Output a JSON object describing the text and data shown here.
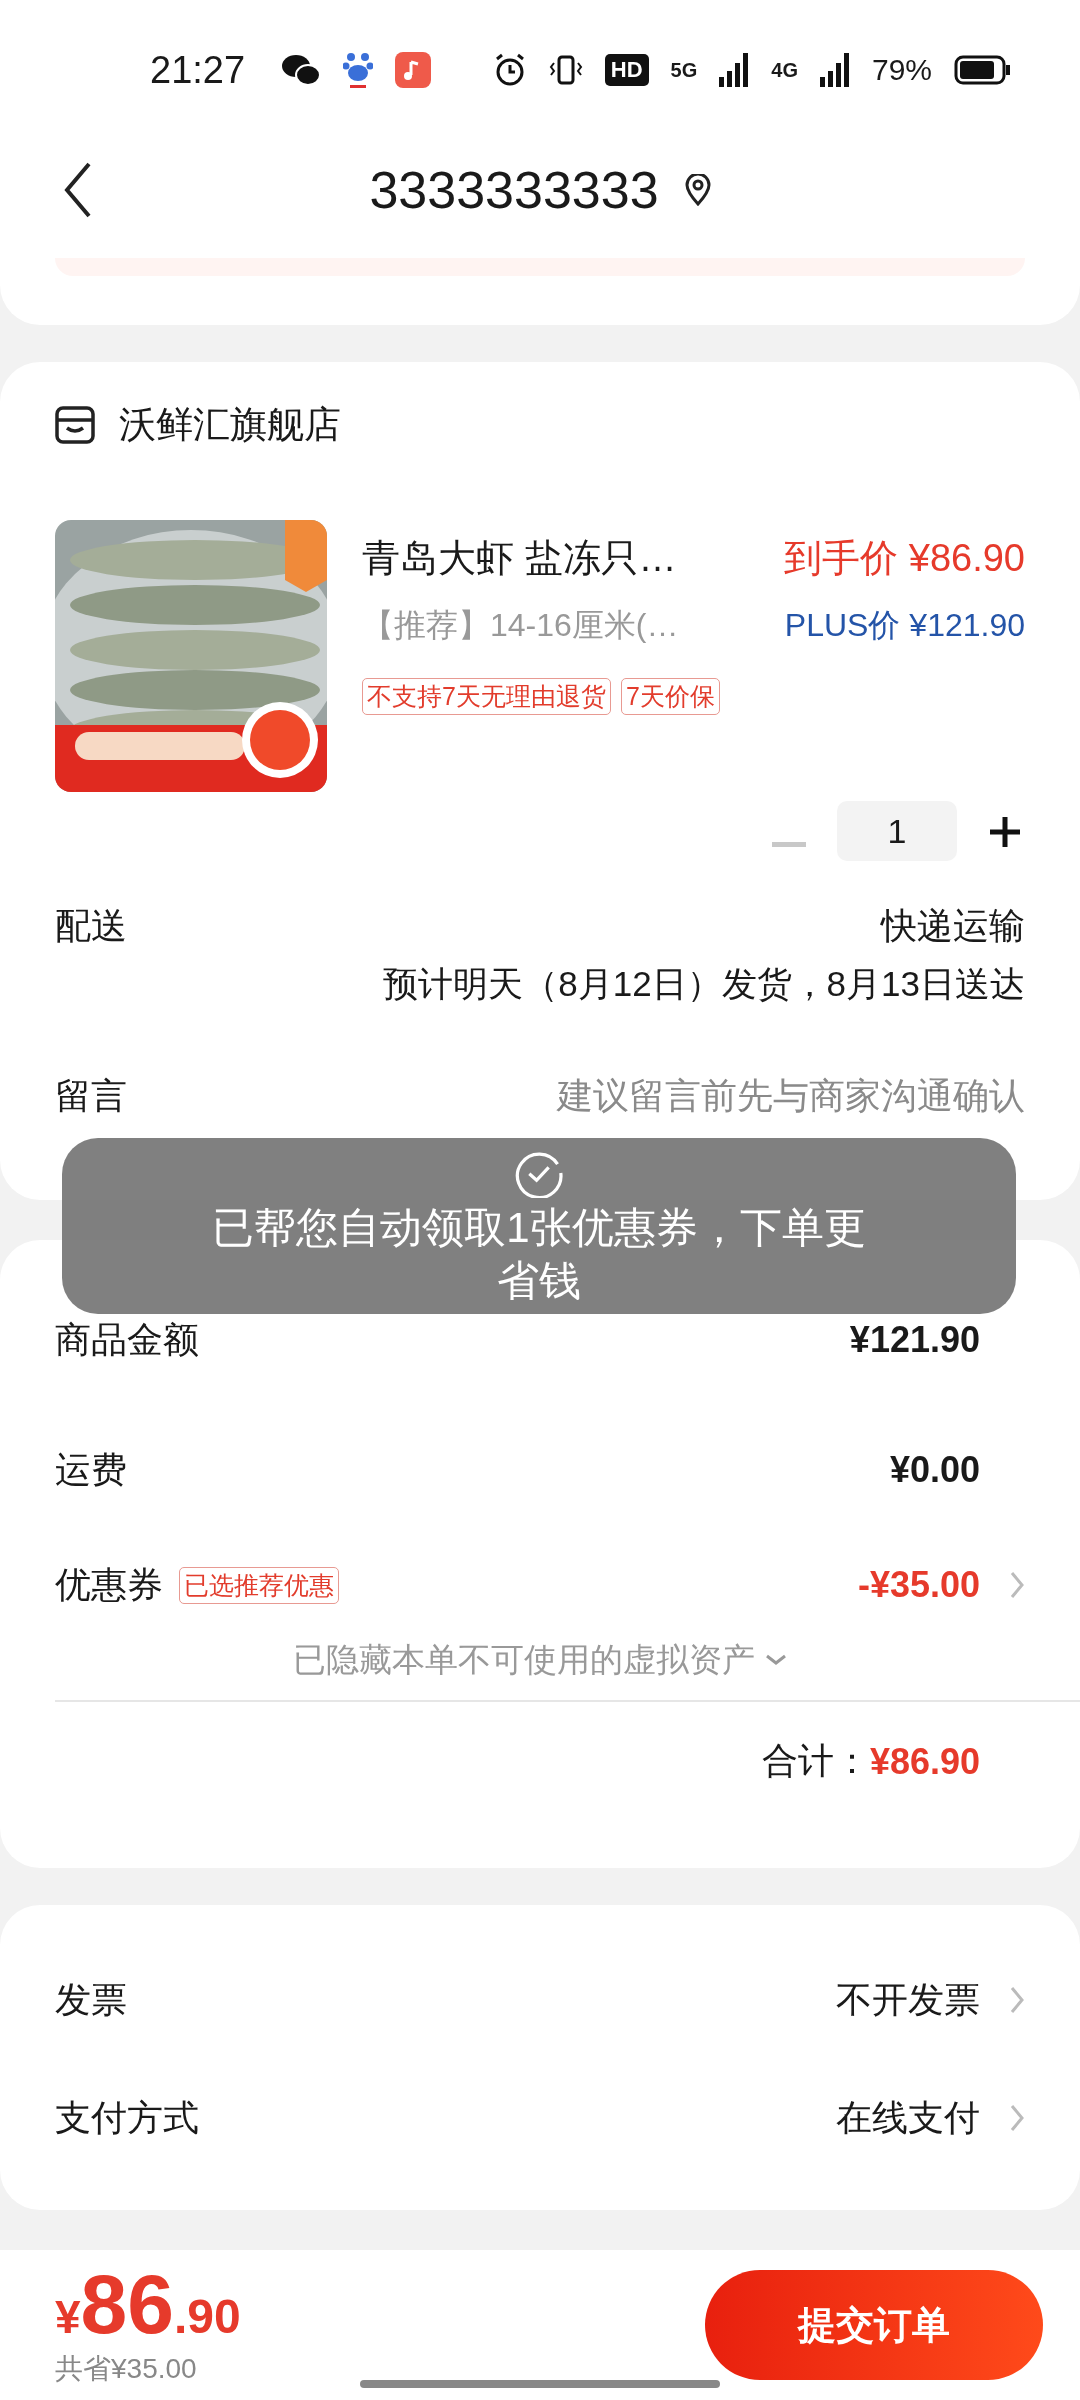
{
  "status_bar": {
    "time": "21:27",
    "hd": "HD",
    "networks": [
      "5G",
      "4G"
    ],
    "battery": "79%"
  },
  "header": {
    "title": "3333333333"
  },
  "store": {
    "name": "沃鲜汇旗舰店"
  },
  "product": {
    "title": "青岛大虾 盐冻只…",
    "spec": "【推荐】14-16厘米(…",
    "final_price": "到手价 ¥86.90",
    "plus_price": "PLUS价 ¥121.90",
    "tags": [
      "不支持7天无理由退货",
      "7天价保"
    ],
    "quantity": "1",
    "minus_disabled": true
  },
  "delivery": {
    "label": "配送",
    "method": "快递运输",
    "estimate": "预计明天（8月12日）发货，8月13日送达"
  },
  "message": {
    "label": "留言",
    "placeholder": "建议留言前先与商家沟通确认"
  },
  "summary": {
    "rows": [
      {
        "kind": "plain",
        "label": "商品金额",
        "value": "¥121.90"
      },
      {
        "kind": "plain",
        "label": "运费",
        "value": "¥0.00"
      },
      {
        "kind": "coupon",
        "label": "优惠券",
        "badge": "已选推荐优惠",
        "value": "-¥35.00"
      }
    ],
    "hidden_note": "已隐藏本单不可使用的虚拟资产",
    "total_label": "合计：",
    "total": "¥86.90"
  },
  "options": [
    {
      "label": "发票",
      "value": "不开发票"
    },
    {
      "label": "支付方式",
      "value": "在线支付"
    }
  ],
  "footer": {
    "currency": "¥",
    "price_int": "86",
    "price_dec": ".90",
    "saved": "共省¥35.00",
    "submit": "提交订单"
  },
  "toast": {
    "message": "已帮您自动领取1张优惠券，下单更省钱"
  }
}
